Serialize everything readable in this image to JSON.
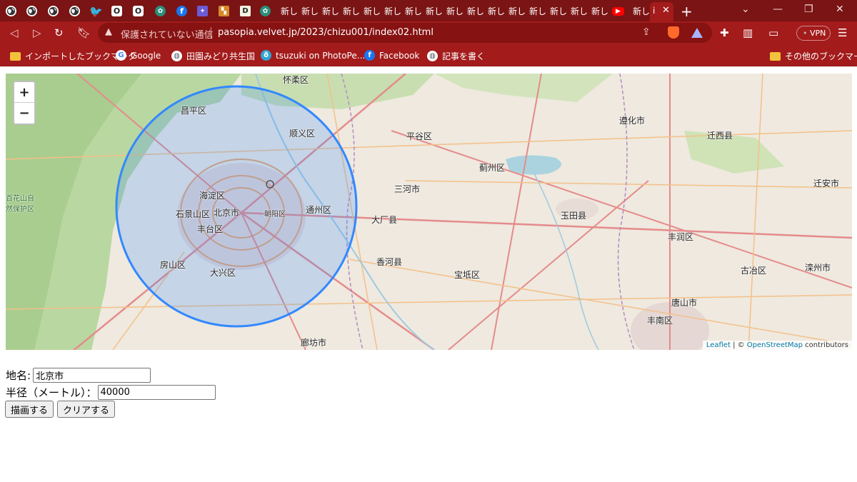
{
  "browser": {
    "tab_title_short": "新し",
    "active_tab_title": "i",
    "new_tab": "+",
    "security_label": "保護されていない通信",
    "url": "pasopia.velvet.jp/2023/chizu001/index02.html",
    "vpn_label": "VPN"
  },
  "bookmarks": {
    "items": [
      {
        "label": "インポートしたブックマーク",
        "icon": "folder-icon"
      },
      {
        "label": "Google",
        "icon": "google-icon"
      },
      {
        "label": "田園みどり共生国",
        "icon": "globe-icon"
      },
      {
        "label": "tsuzuki on PhotoPe...",
        "icon": "photopea-icon"
      },
      {
        "label": "Facebook",
        "icon": "facebook-icon"
      },
      {
        "label": "記事を書く",
        "icon": "globe-icon"
      }
    ],
    "other_label": "その他のブックマーク"
  },
  "map": {
    "zoom_in": "+",
    "zoom_out": "−",
    "attribution_leaflet": "Leaflet",
    "attribution_sep": " | © ",
    "attribution_osm": "OpenStreetMap",
    "attribution_tail": " contributors",
    "circle_color": "#3388ff",
    "labels": {
      "beijing": "北京市",
      "haidian": "海淀区",
      "chaoyang": "朝阳区",
      "changping": "昌平区",
      "shunyi": "顺义区",
      "tongzhou": "通州区",
      "fengtai": "丰台区",
      "shijingshan": "石景山区",
      "fangshan": "房山区",
      "daxing": "大兴区",
      "sanhe": "三河市",
      "dachang": "大厂县",
      "xianghe": "香河县",
      "baodi": "宝坻区",
      "yutian": "玉田县",
      "zunhua": "遵化市",
      "qianxi": "迁西县",
      "fengrun": "丰润区",
      "tangshan": "唐山市",
      "guye": "古冶区",
      "luanzhou": "滦州市",
      "langfang": "廊坊市",
      "jizhou": "蓟州区",
      "pinggu": "平谷区",
      "huairou": "怀柔区",
      "qiananshan": "迁安市",
      "fengnan": "丰南区",
      "park": "百花山自然保护区"
    }
  },
  "form": {
    "place_label": "地名:",
    "place_value": "北京市",
    "radius_label": "半径（メートル）：",
    "radius_value": "40000",
    "draw_button": "描画する",
    "clear_button": "クリアする"
  }
}
